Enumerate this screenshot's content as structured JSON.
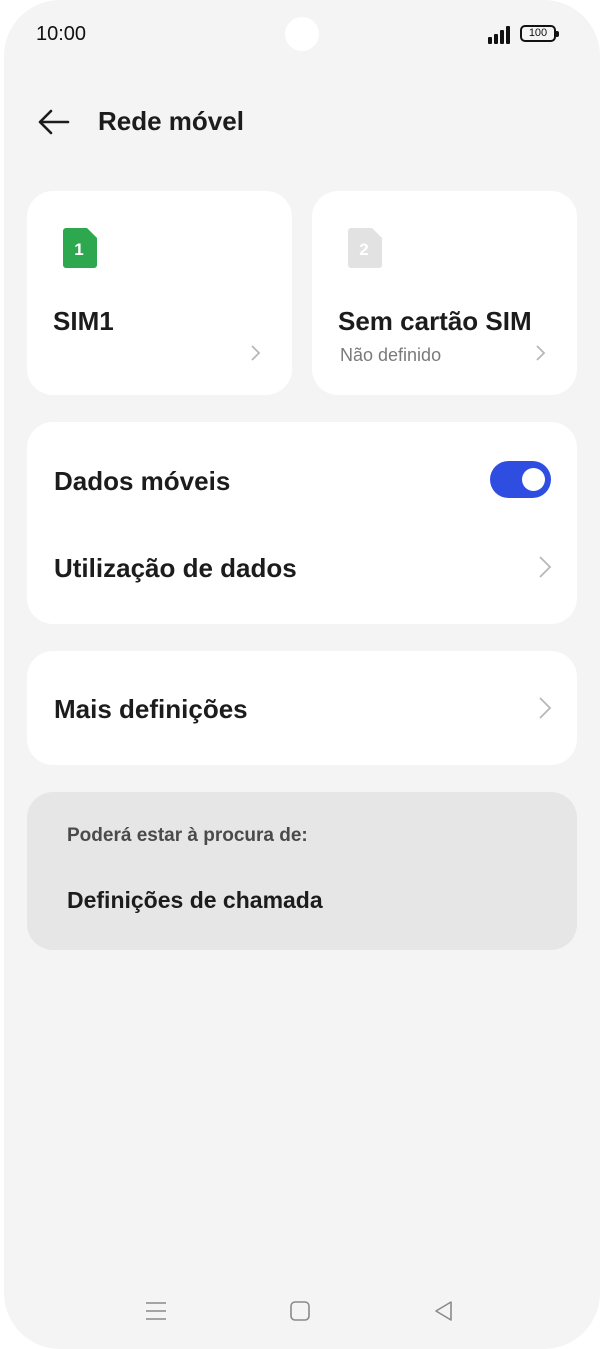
{
  "status_bar": {
    "time": "10:00",
    "battery": "100",
    "icons": [
      "signal-icon",
      "battery-icon"
    ]
  },
  "header": {
    "title": "Rede móvel",
    "back_icon": "arrow-left-icon"
  },
  "sims": [
    {
      "badge": "1",
      "name": "SIM1",
      "subtitle": "",
      "color": "#2ea84f"
    },
    {
      "badge": "2",
      "name": "Sem cartão SIM",
      "subtitle": "Não definido",
      "color": "#e2e2e2"
    }
  ],
  "data_section": {
    "mobile_data_label": "Dados móveis",
    "mobile_data_on": true,
    "usage_label": "Utilização de dados"
  },
  "more_settings_label": "Mais definições",
  "suggestions": {
    "heading": "Poderá estar à procura de:",
    "item": "Definições de chamada"
  },
  "colors": {
    "accent": "#2f4de0",
    "background": "#f4f4f4",
    "card": "#ffffff",
    "suggestion_bg": "#e6e6e6"
  },
  "nav_bar": [
    "menu-icon",
    "home-icon",
    "back-triangle-icon"
  ]
}
